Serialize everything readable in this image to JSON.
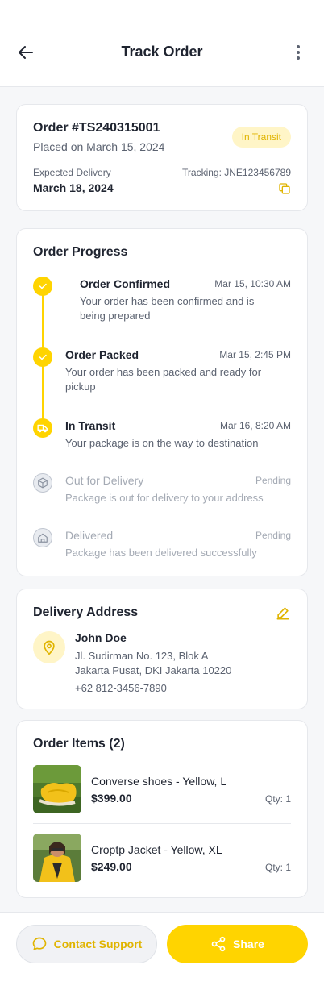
{
  "header": {
    "title": "Track Order"
  },
  "summary": {
    "order_id": "Order #TS240315001",
    "placed": "Placed on March 15, 2024",
    "status": "In Transit",
    "expected_label": "Expected Delivery",
    "expected_date": "March 18, 2024",
    "tracking": "Tracking: JNE123456789"
  },
  "progress": {
    "title": "Order Progress",
    "steps": [
      {
        "title": "Order Confirmed",
        "time": "Mar 15, 10:30 AM",
        "desc1": "Your order has been confirmed and is",
        "desc2": "being prepared",
        "state": "done",
        "icon": "check-icon"
      },
      {
        "title": "Order Packed",
        "time": "Mar 15, 2:45 PM",
        "desc1": "Your order has been packed and ready for",
        "desc2": "pickup",
        "state": "done",
        "icon": "check-icon"
      },
      {
        "title": "In Transit",
        "time": "Mar 16, 8:20 AM",
        "desc1": "Your package is on the way to destination",
        "state": "done",
        "icon": "truck-icon"
      },
      {
        "title": "Out for Delivery",
        "time": "Pending",
        "desc1": "Package is out for delivery to your address",
        "state": "pending",
        "icon": "box-icon"
      },
      {
        "title": "Delivered",
        "time": "Pending",
        "desc1": "Package has been delivered successfully",
        "state": "pending",
        "icon": "home-icon"
      }
    ]
  },
  "address": {
    "title": "Delivery Address",
    "name": "John Doe",
    "line1": "Jl. Sudirman No. 123, Blok A",
    "line2": "Jakarta Pusat, DKI Jakarta 10220",
    "phone": "+62 812-3456-7890"
  },
  "items": {
    "title": "Order Items (2)",
    "list": [
      {
        "name": "Converse shoes - Yellow, L",
        "price": "$399.00",
        "qty": "Qty: 1"
      },
      {
        "name": "Croptp Jacket - Yellow, XL",
        "price": "$249.00",
        "qty": "Qty: 1"
      }
    ]
  },
  "footer": {
    "support_label": "Contact Support",
    "share_label": "Share"
  },
  "colors": {
    "accent": "#FFD400",
    "accent_soft": "#FFF5C7",
    "text": "#1F2430",
    "muted": "#5B6270"
  }
}
